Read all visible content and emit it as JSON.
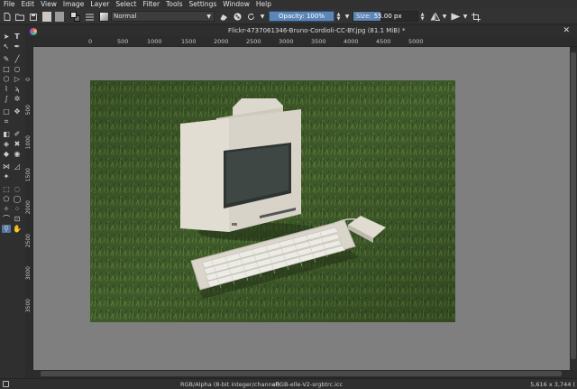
{
  "menu": [
    "File",
    "Edit",
    "View",
    "Image",
    "Layer",
    "Select",
    "Filter",
    "Tools",
    "Settings",
    "Window",
    "Help"
  ],
  "toolbar": {
    "blend_mode": "Normal",
    "opacity_label": "Opacity: 100%",
    "size_label": "Size:",
    "size_value": "55.00 px",
    "opacity_percent": 100,
    "foreground_color": "#d9d9d9",
    "background_color": "#6b6b6b"
  },
  "document": {
    "title": "Flickr-4737061346-Bruno-Cordioli-CC-BY.jpg (81.1 MiB) *",
    "close_glyph": "✕"
  },
  "ruler": {
    "h_ticks": [
      "0",
      "500",
      "1000",
      "1500",
      "2000",
      "2500",
      "3000",
      "3500",
      "4000",
      "4500",
      "5000"
    ],
    "v_ticks": [
      "0",
      "500",
      "1000",
      "1500",
      "2000",
      "2500",
      "3000",
      "3500"
    ]
  },
  "status": {
    "colorspace": "RGB/Alpha (8-bit integer/channel)",
    "profile": "sRGB-elle-V2-srgbtrc.icc",
    "dimensions": "5,616 x 3,744 ("
  },
  "colors": {
    "accent": "#5d86b6",
    "canvas_bg": "#7f7f7f",
    "panel_bg": "#2f2f2f"
  }
}
